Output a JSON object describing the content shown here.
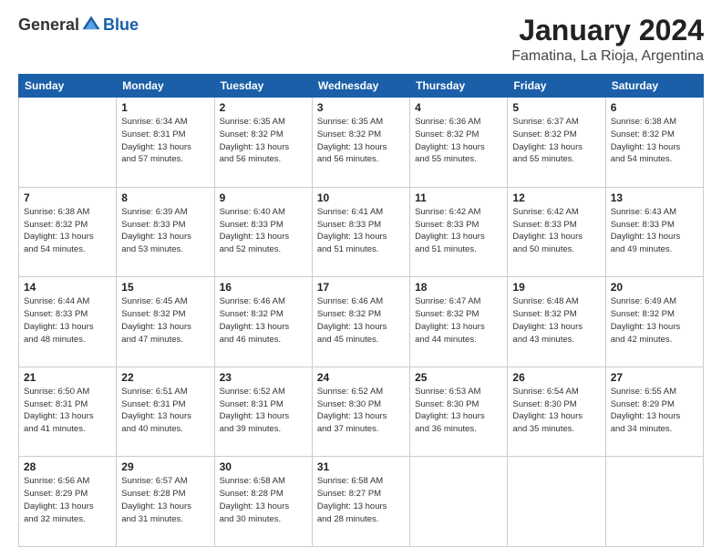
{
  "logo": {
    "general": "General",
    "blue": "Blue"
  },
  "title": "January 2024",
  "location": "Famatina, La Rioja, Argentina",
  "weekdays": [
    "Sunday",
    "Monday",
    "Tuesday",
    "Wednesday",
    "Thursday",
    "Friday",
    "Saturday"
  ],
  "weeks": [
    [
      {
        "day": "",
        "info": ""
      },
      {
        "day": "1",
        "info": "Sunrise: 6:34 AM\nSunset: 8:31 PM\nDaylight: 13 hours\nand 57 minutes."
      },
      {
        "day": "2",
        "info": "Sunrise: 6:35 AM\nSunset: 8:32 PM\nDaylight: 13 hours\nand 56 minutes."
      },
      {
        "day": "3",
        "info": "Sunrise: 6:35 AM\nSunset: 8:32 PM\nDaylight: 13 hours\nand 56 minutes."
      },
      {
        "day": "4",
        "info": "Sunrise: 6:36 AM\nSunset: 8:32 PM\nDaylight: 13 hours\nand 55 minutes."
      },
      {
        "day": "5",
        "info": "Sunrise: 6:37 AM\nSunset: 8:32 PM\nDaylight: 13 hours\nand 55 minutes."
      },
      {
        "day": "6",
        "info": "Sunrise: 6:38 AM\nSunset: 8:32 PM\nDaylight: 13 hours\nand 54 minutes."
      }
    ],
    [
      {
        "day": "7",
        "info": "Sunrise: 6:38 AM\nSunset: 8:32 PM\nDaylight: 13 hours\nand 54 minutes."
      },
      {
        "day": "8",
        "info": "Sunrise: 6:39 AM\nSunset: 8:33 PM\nDaylight: 13 hours\nand 53 minutes."
      },
      {
        "day": "9",
        "info": "Sunrise: 6:40 AM\nSunset: 8:33 PM\nDaylight: 13 hours\nand 52 minutes."
      },
      {
        "day": "10",
        "info": "Sunrise: 6:41 AM\nSunset: 8:33 PM\nDaylight: 13 hours\nand 51 minutes."
      },
      {
        "day": "11",
        "info": "Sunrise: 6:42 AM\nSunset: 8:33 PM\nDaylight: 13 hours\nand 51 minutes."
      },
      {
        "day": "12",
        "info": "Sunrise: 6:42 AM\nSunset: 8:33 PM\nDaylight: 13 hours\nand 50 minutes."
      },
      {
        "day": "13",
        "info": "Sunrise: 6:43 AM\nSunset: 8:33 PM\nDaylight: 13 hours\nand 49 minutes."
      }
    ],
    [
      {
        "day": "14",
        "info": "Sunrise: 6:44 AM\nSunset: 8:33 PM\nDaylight: 13 hours\nand 48 minutes."
      },
      {
        "day": "15",
        "info": "Sunrise: 6:45 AM\nSunset: 8:32 PM\nDaylight: 13 hours\nand 47 minutes."
      },
      {
        "day": "16",
        "info": "Sunrise: 6:46 AM\nSunset: 8:32 PM\nDaylight: 13 hours\nand 46 minutes."
      },
      {
        "day": "17",
        "info": "Sunrise: 6:46 AM\nSunset: 8:32 PM\nDaylight: 13 hours\nand 45 minutes."
      },
      {
        "day": "18",
        "info": "Sunrise: 6:47 AM\nSunset: 8:32 PM\nDaylight: 13 hours\nand 44 minutes."
      },
      {
        "day": "19",
        "info": "Sunrise: 6:48 AM\nSunset: 8:32 PM\nDaylight: 13 hours\nand 43 minutes."
      },
      {
        "day": "20",
        "info": "Sunrise: 6:49 AM\nSunset: 8:32 PM\nDaylight: 13 hours\nand 42 minutes."
      }
    ],
    [
      {
        "day": "21",
        "info": "Sunrise: 6:50 AM\nSunset: 8:31 PM\nDaylight: 13 hours\nand 41 minutes."
      },
      {
        "day": "22",
        "info": "Sunrise: 6:51 AM\nSunset: 8:31 PM\nDaylight: 13 hours\nand 40 minutes."
      },
      {
        "day": "23",
        "info": "Sunrise: 6:52 AM\nSunset: 8:31 PM\nDaylight: 13 hours\nand 39 minutes."
      },
      {
        "day": "24",
        "info": "Sunrise: 6:52 AM\nSunset: 8:30 PM\nDaylight: 13 hours\nand 37 minutes."
      },
      {
        "day": "25",
        "info": "Sunrise: 6:53 AM\nSunset: 8:30 PM\nDaylight: 13 hours\nand 36 minutes."
      },
      {
        "day": "26",
        "info": "Sunrise: 6:54 AM\nSunset: 8:30 PM\nDaylight: 13 hours\nand 35 minutes."
      },
      {
        "day": "27",
        "info": "Sunrise: 6:55 AM\nSunset: 8:29 PM\nDaylight: 13 hours\nand 34 minutes."
      }
    ],
    [
      {
        "day": "28",
        "info": "Sunrise: 6:56 AM\nSunset: 8:29 PM\nDaylight: 13 hours\nand 32 minutes."
      },
      {
        "day": "29",
        "info": "Sunrise: 6:57 AM\nSunset: 8:28 PM\nDaylight: 13 hours\nand 31 minutes."
      },
      {
        "day": "30",
        "info": "Sunrise: 6:58 AM\nSunset: 8:28 PM\nDaylight: 13 hours\nand 30 minutes."
      },
      {
        "day": "31",
        "info": "Sunrise: 6:58 AM\nSunset: 8:27 PM\nDaylight: 13 hours\nand 28 minutes."
      },
      {
        "day": "",
        "info": ""
      },
      {
        "day": "",
        "info": ""
      },
      {
        "day": "",
        "info": ""
      }
    ]
  ]
}
